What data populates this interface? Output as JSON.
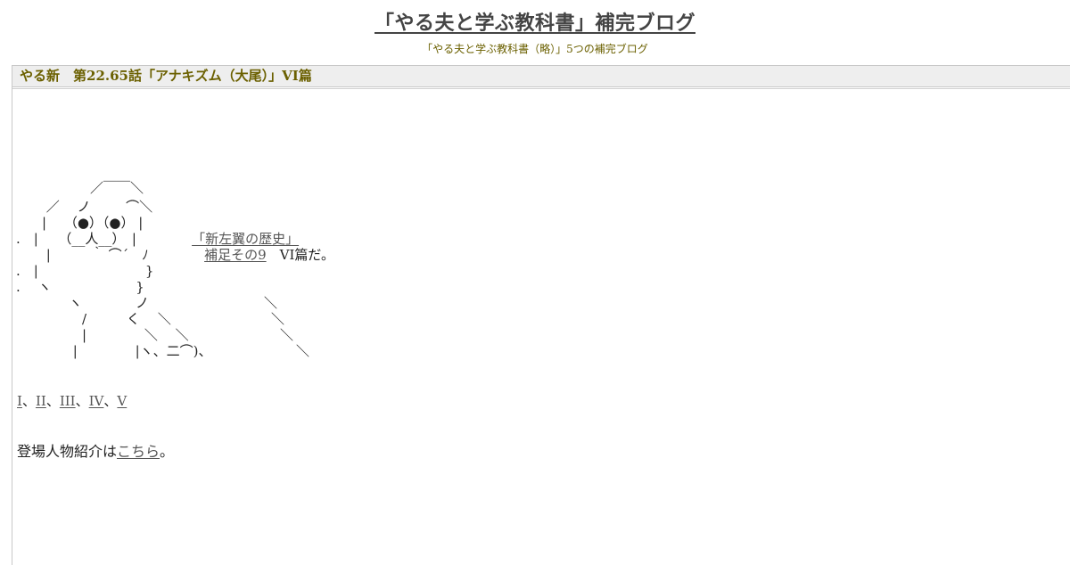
{
  "header": {
    "title": "「やる夫と学ぶ教科書」補完ブログ",
    "subtitle": "「やる夫と学ぶ教科書（略）」5つの補完ブログ"
  },
  "entry": {
    "title": "やる新　第22.65話「アナキズム（大尾）」VI篇",
    "aa_lines": [
      "　　　／￣￣＼",
      "　 ／　 ノ 　　 ⌒＼",
      "　|　 （●）（●） |",
      ".　|　　（__人__）　|",
      "　 |　　　｀ ⌒´　ﾉ",
      ".　|　　　　　　　　}",
      ".　 ヽ　　　　　　 }",
      "　　　ヽ　　　　ノ",
      "　　　　/　　　く　 ＼",
      "　　　　|　　　　 ＼　 ＼",
      "　　　 |　　　　 |ヽ、二⌒)、"
    ],
    "aa_right": [
      "＼",
      "＼",
      "＼",
      "＼"
    ],
    "speech": {
      "link1": "「新左翼の歴史」",
      "link2": "補足その9",
      "tail": "VI篇だ。"
    },
    "parts": [
      "I",
      "II",
      "III",
      "IV",
      "V"
    ],
    "parts_sep": "、",
    "intro_text": "登場人物紹介は",
    "intro_link": "こちら",
    "intro_end": "。"
  }
}
